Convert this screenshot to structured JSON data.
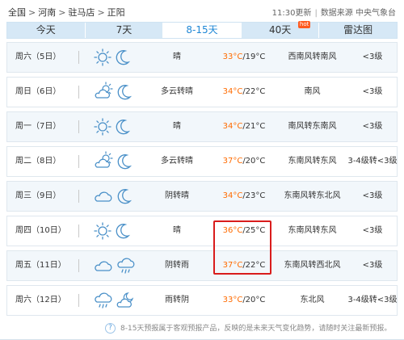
{
  "header": {
    "breadcrumb": [
      "全国",
      "河南",
      "驻马店",
      "正阳"
    ],
    "separator": ">",
    "update": "11:30更新",
    "source": "数据来源 中央气象台"
  },
  "tabs": [
    {
      "label": "今天",
      "active": false
    },
    {
      "label": "7天",
      "active": false
    },
    {
      "label": "8-15天",
      "active": true
    },
    {
      "label": "40天",
      "active": false,
      "badge": "hot"
    },
    {
      "label": "雷达图",
      "active": false
    }
  ],
  "forecast": [
    {
      "day": "周六（5日）",
      "icons": [
        "sun-icon",
        "moon-icon"
      ],
      "weather": "晴",
      "high": "33°C",
      "low": "/19°C",
      "wind": "西南风转南风",
      "level": "<3级"
    },
    {
      "day": "周日（6日）",
      "icons": [
        "partly-cloudy-icon",
        "moon-icon"
      ],
      "weather": "多云转晴",
      "high": "34°C",
      "low": "/22°C",
      "wind": "南风",
      "level": "<3级"
    },
    {
      "day": "周一（7日）",
      "icons": [
        "sun-icon",
        "moon-icon"
      ],
      "weather": "晴",
      "high": "34°C",
      "low": "/21°C",
      "wind": "南风转东南风",
      "level": "<3级"
    },
    {
      "day": "周二（8日）",
      "icons": [
        "partly-cloudy-icon",
        "moon-icon"
      ],
      "weather": "多云转晴",
      "high": "37°C",
      "low": "/20°C",
      "wind": "东南风转东风",
      "level": "3-4级转<3级"
    },
    {
      "day": "周三（9日）",
      "icons": [
        "cloud-icon",
        "moon-icon"
      ],
      "weather": "阴转晴",
      "high": "34°C",
      "low": "/23°C",
      "wind": "东南风转东北风",
      "level": "<3级"
    },
    {
      "day": "周四（10日）",
      "icons": [
        "sun-icon",
        "moon-icon"
      ],
      "weather": "晴",
      "high": "36°C",
      "low": "/25°C",
      "wind": "东南风转东风",
      "level": "<3级"
    },
    {
      "day": "周五（11日）",
      "icons": [
        "cloud-icon",
        "rain-icon"
      ],
      "weather": "阴转雨",
      "high": "37°C",
      "low": "/22°C",
      "wind": "东南风转西北风",
      "level": "<3级"
    },
    {
      "day": "周六（12日）",
      "icons": [
        "rain-icon",
        "partly-cloudy-night-icon"
      ],
      "weather": "雨转阴",
      "high": "33°C",
      "low": "/20°C",
      "wind": "东北风",
      "level": "3-4级转<3级"
    }
  ],
  "footer": {
    "help_glyph": "?",
    "note": "8-15天预报属于客观预报产品，反映的是未来天气变化趋势，请随时关注最新预报。"
  },
  "colors": {
    "high_temp": "#ff6b00",
    "tab_active_text": "#1e87d6",
    "tab_bg": "#d6e8f6",
    "highlight_box": "#d91c1c",
    "icon_stroke": "#4a90c8"
  }
}
